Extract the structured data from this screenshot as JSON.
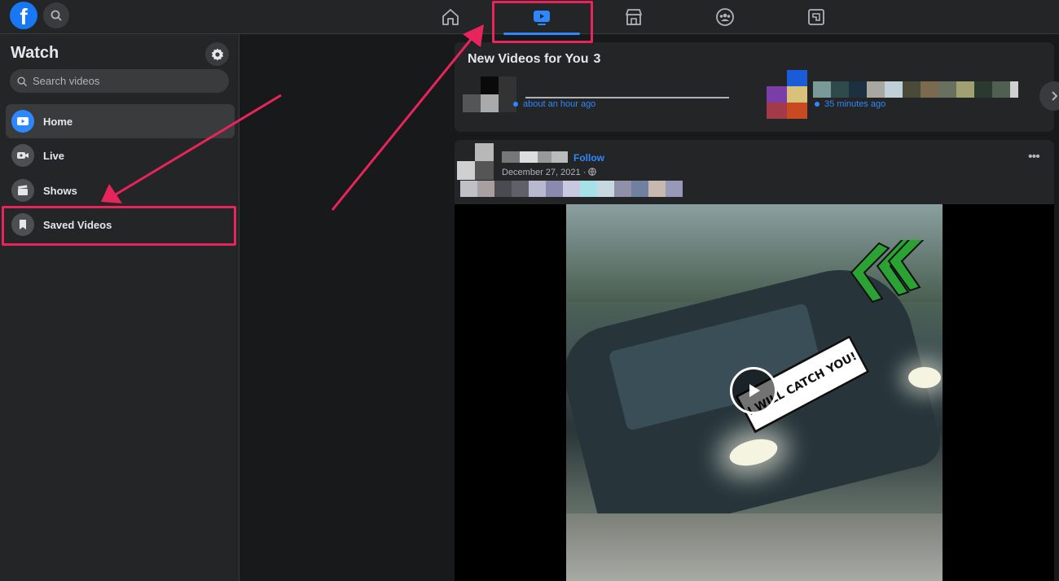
{
  "topbar": {
    "logo": "f",
    "search_icon": "search-icon",
    "tabs": [
      {
        "name": "home",
        "icon": "home-icon",
        "active": false
      },
      {
        "name": "watch",
        "icon": "watch-icon",
        "active": true
      },
      {
        "name": "marketplace",
        "icon": "marketplace-icon",
        "active": false
      },
      {
        "name": "groups",
        "icon": "groups-icon",
        "active": false
      },
      {
        "name": "gaming",
        "icon": "gaming-icon",
        "active": false
      }
    ]
  },
  "sidebar": {
    "title": "Watch",
    "search_placeholder": "Search videos",
    "items": [
      {
        "label": "Home",
        "icon": "play-icon",
        "active": true
      },
      {
        "label": "Live",
        "icon": "live-camera-icon",
        "active": false
      },
      {
        "label": "Shows",
        "icon": "clapperboard-icon",
        "active": false
      },
      {
        "label": "Saved Videos",
        "icon": "bookmark-icon",
        "active": false
      }
    ]
  },
  "new_videos": {
    "title": "New Videos for You",
    "count": "3",
    "items": [
      {
        "time": "about an hour ago"
      },
      {
        "time": "35 minutes ago"
      }
    ]
  },
  "post": {
    "follow_label": "Follow",
    "date": "December 27, 2021 ·",
    "more_label": "•••",
    "video_sticker": "I WILL CATCH YOU!"
  },
  "colors": {
    "accent": "#2d88ff",
    "annotation": "#e8245c",
    "background": "#18191a",
    "surface": "#242526"
  }
}
